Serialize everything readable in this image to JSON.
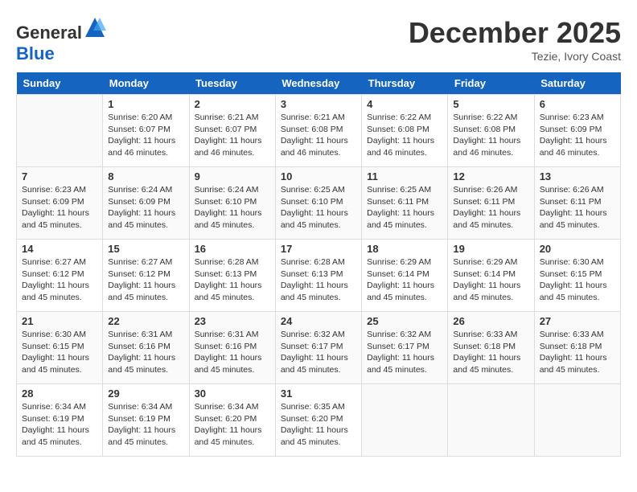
{
  "header": {
    "logo_general": "General",
    "logo_blue": "Blue",
    "title": "December 2025",
    "location": "Tezie, Ivory Coast"
  },
  "days_of_week": [
    "Sunday",
    "Monday",
    "Tuesday",
    "Wednesday",
    "Thursday",
    "Friday",
    "Saturday"
  ],
  "weeks": [
    [
      {
        "day": "",
        "sunrise": "",
        "sunset": "",
        "daylight": ""
      },
      {
        "day": "1",
        "sunrise": "Sunrise: 6:20 AM",
        "sunset": "Sunset: 6:07 PM",
        "daylight": "Daylight: 11 hours and 46 minutes."
      },
      {
        "day": "2",
        "sunrise": "Sunrise: 6:21 AM",
        "sunset": "Sunset: 6:07 PM",
        "daylight": "Daylight: 11 hours and 46 minutes."
      },
      {
        "day": "3",
        "sunrise": "Sunrise: 6:21 AM",
        "sunset": "Sunset: 6:08 PM",
        "daylight": "Daylight: 11 hours and 46 minutes."
      },
      {
        "day": "4",
        "sunrise": "Sunrise: 6:22 AM",
        "sunset": "Sunset: 6:08 PM",
        "daylight": "Daylight: 11 hours and 46 minutes."
      },
      {
        "day": "5",
        "sunrise": "Sunrise: 6:22 AM",
        "sunset": "Sunset: 6:08 PM",
        "daylight": "Daylight: 11 hours and 46 minutes."
      },
      {
        "day": "6",
        "sunrise": "Sunrise: 6:23 AM",
        "sunset": "Sunset: 6:09 PM",
        "daylight": "Daylight: 11 hours and 46 minutes."
      }
    ],
    [
      {
        "day": "7",
        "sunrise": "Sunrise: 6:23 AM",
        "sunset": "Sunset: 6:09 PM",
        "daylight": "Daylight: 11 hours and 45 minutes."
      },
      {
        "day": "8",
        "sunrise": "Sunrise: 6:24 AM",
        "sunset": "Sunset: 6:09 PM",
        "daylight": "Daylight: 11 hours and 45 minutes."
      },
      {
        "day": "9",
        "sunrise": "Sunrise: 6:24 AM",
        "sunset": "Sunset: 6:10 PM",
        "daylight": "Daylight: 11 hours and 45 minutes."
      },
      {
        "day": "10",
        "sunrise": "Sunrise: 6:25 AM",
        "sunset": "Sunset: 6:10 PM",
        "daylight": "Daylight: 11 hours and 45 minutes."
      },
      {
        "day": "11",
        "sunrise": "Sunrise: 6:25 AM",
        "sunset": "Sunset: 6:11 PM",
        "daylight": "Daylight: 11 hours and 45 minutes."
      },
      {
        "day": "12",
        "sunrise": "Sunrise: 6:26 AM",
        "sunset": "Sunset: 6:11 PM",
        "daylight": "Daylight: 11 hours and 45 minutes."
      },
      {
        "day": "13",
        "sunrise": "Sunrise: 6:26 AM",
        "sunset": "Sunset: 6:11 PM",
        "daylight": "Daylight: 11 hours and 45 minutes."
      }
    ],
    [
      {
        "day": "14",
        "sunrise": "Sunrise: 6:27 AM",
        "sunset": "Sunset: 6:12 PM",
        "daylight": "Daylight: 11 hours and 45 minutes."
      },
      {
        "day": "15",
        "sunrise": "Sunrise: 6:27 AM",
        "sunset": "Sunset: 6:12 PM",
        "daylight": "Daylight: 11 hours and 45 minutes."
      },
      {
        "day": "16",
        "sunrise": "Sunrise: 6:28 AM",
        "sunset": "Sunset: 6:13 PM",
        "daylight": "Daylight: 11 hours and 45 minutes."
      },
      {
        "day": "17",
        "sunrise": "Sunrise: 6:28 AM",
        "sunset": "Sunset: 6:13 PM",
        "daylight": "Daylight: 11 hours and 45 minutes."
      },
      {
        "day": "18",
        "sunrise": "Sunrise: 6:29 AM",
        "sunset": "Sunset: 6:14 PM",
        "daylight": "Daylight: 11 hours and 45 minutes."
      },
      {
        "day": "19",
        "sunrise": "Sunrise: 6:29 AM",
        "sunset": "Sunset: 6:14 PM",
        "daylight": "Daylight: 11 hours and 45 minutes."
      },
      {
        "day": "20",
        "sunrise": "Sunrise: 6:30 AM",
        "sunset": "Sunset: 6:15 PM",
        "daylight": "Daylight: 11 hours and 45 minutes."
      }
    ],
    [
      {
        "day": "21",
        "sunrise": "Sunrise: 6:30 AM",
        "sunset": "Sunset: 6:15 PM",
        "daylight": "Daylight: 11 hours and 45 minutes."
      },
      {
        "day": "22",
        "sunrise": "Sunrise: 6:31 AM",
        "sunset": "Sunset: 6:16 PM",
        "daylight": "Daylight: 11 hours and 45 minutes."
      },
      {
        "day": "23",
        "sunrise": "Sunrise: 6:31 AM",
        "sunset": "Sunset: 6:16 PM",
        "daylight": "Daylight: 11 hours and 45 minutes."
      },
      {
        "day": "24",
        "sunrise": "Sunrise: 6:32 AM",
        "sunset": "Sunset: 6:17 PM",
        "daylight": "Daylight: 11 hours and 45 minutes."
      },
      {
        "day": "25",
        "sunrise": "Sunrise: 6:32 AM",
        "sunset": "Sunset: 6:17 PM",
        "daylight": "Daylight: 11 hours and 45 minutes."
      },
      {
        "day": "26",
        "sunrise": "Sunrise: 6:33 AM",
        "sunset": "Sunset: 6:18 PM",
        "daylight": "Daylight: 11 hours and 45 minutes."
      },
      {
        "day": "27",
        "sunrise": "Sunrise: 6:33 AM",
        "sunset": "Sunset: 6:18 PM",
        "daylight": "Daylight: 11 hours and 45 minutes."
      }
    ],
    [
      {
        "day": "28",
        "sunrise": "Sunrise: 6:34 AM",
        "sunset": "Sunset: 6:19 PM",
        "daylight": "Daylight: 11 hours and 45 minutes."
      },
      {
        "day": "29",
        "sunrise": "Sunrise: 6:34 AM",
        "sunset": "Sunset: 6:19 PM",
        "daylight": "Daylight: 11 hours and 45 minutes."
      },
      {
        "day": "30",
        "sunrise": "Sunrise: 6:34 AM",
        "sunset": "Sunset: 6:20 PM",
        "daylight": "Daylight: 11 hours and 45 minutes."
      },
      {
        "day": "31",
        "sunrise": "Sunrise: 6:35 AM",
        "sunset": "Sunset: 6:20 PM",
        "daylight": "Daylight: 11 hours and 45 minutes."
      },
      {
        "day": "",
        "sunrise": "",
        "sunset": "",
        "daylight": ""
      },
      {
        "day": "",
        "sunrise": "",
        "sunset": "",
        "daylight": ""
      },
      {
        "day": "",
        "sunrise": "",
        "sunset": "",
        "daylight": ""
      }
    ]
  ]
}
